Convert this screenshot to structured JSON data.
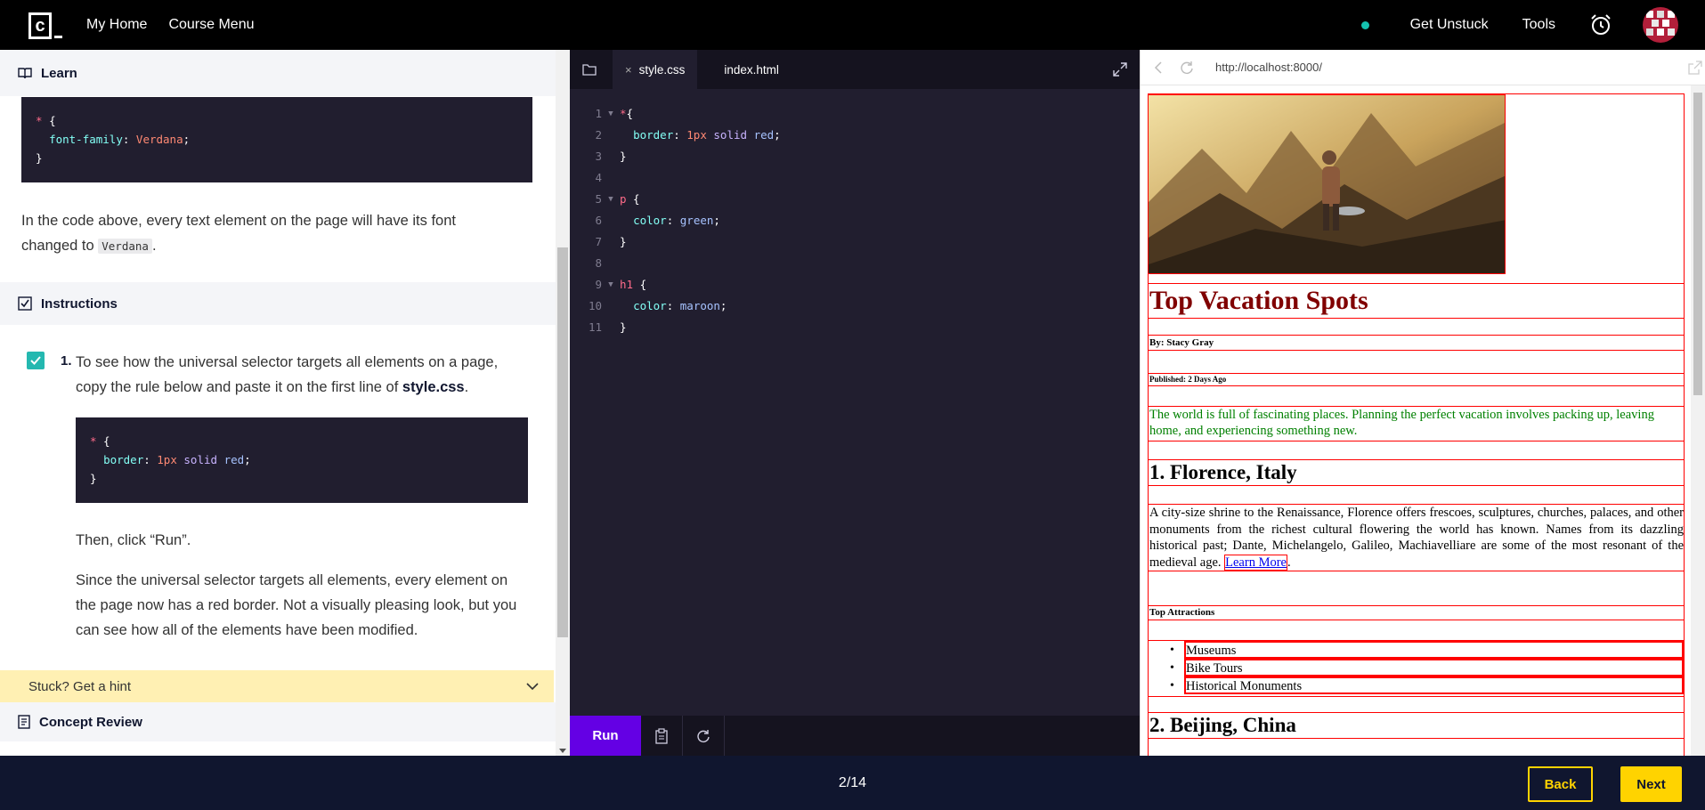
{
  "topbar": {
    "logo_letter": "c",
    "nav": [
      "My Home",
      "Course Menu"
    ],
    "get_unstuck": "Get Unstuck",
    "tools": "Tools"
  },
  "learn": {
    "learn_heading": "Learn",
    "example_code": [
      "* {",
      "  font-family: Verdana;",
      "}"
    ],
    "para1_a": "In the code above, every text element on the page will have its font changed to ",
    "para1_code": "Verdana",
    "para1_b": ".",
    "instructions_heading": "Instructions",
    "step_number": "1.",
    "step_text_a": "To see how the universal selector targets all elements on a page, copy the rule below and paste it on the first line of ",
    "step_text_bold": "style.css",
    "step_text_b": ".",
    "step_code": [
      "* {",
      "  border: 1px solid red;",
      "}"
    ],
    "then_click": "Then, click “Run”.",
    "since_text": "Since the universal selector targets all elements, every element on the page now has a red border. Not a visually pleasing look, but you can see how all of the elements have been modified.",
    "hint": "Stuck? Get a hint",
    "concept_review": "Concept Review"
  },
  "editor": {
    "tabs": [
      "style.css",
      "index.html"
    ],
    "close_glyph": "×",
    "line_numbers": [
      "1",
      "2",
      "3",
      "4",
      "5",
      "6",
      "7",
      "8",
      "9",
      "10",
      "11"
    ],
    "run_label": "Run"
  },
  "browser": {
    "url": "http://localhost:8000/",
    "title": "Top Vacation Spots",
    "byline": "By: Stacy Gray",
    "published": "Published: 2 Days Ago",
    "intro": "The world is full of fascinating places. Planning the perfect vacation involves packing up, leaving home, and experiencing something new.",
    "dest1_heading": "1. Florence, Italy",
    "dest1_text": "A city-size shrine to the Renaissance, Florence offers frescoes, sculptures, churches, palaces, and other monuments from the richest cultural flowering the world has known. Names from its dazzling historical past; Dante, Michelangelo, Galileo, Machiavelliare are some of the most resonant of the medieval age. ",
    "learn_more": "Learn More",
    "learn_more_after": ".",
    "top_attractions": "Top Attractions",
    "attractions": [
      "Museums",
      "Bike Tours",
      "Historical Monuments"
    ],
    "dest2_heading": "2. Beijing, China"
  },
  "footer": {
    "progress": "2/14",
    "back": "Back",
    "next": "Next"
  },
  "colors": {
    "accent_purple": "#6400e4",
    "yellow": "#ffd300",
    "teal": "#14c2b0",
    "navy": "#10162f",
    "editor_bg": "#211e2f",
    "red_border": "#ff0000",
    "maroon": "#800000",
    "green": "#008000"
  },
  "icons": [
    "logo-icon",
    "status-dot-icon",
    "alarm-clock-icon",
    "avatar",
    "book-icon",
    "checkbox-icon",
    "chevron-down-icon",
    "document-icon",
    "folder-icon",
    "expand-icon",
    "clipboard-icon",
    "refresh-icon",
    "back-arrow-icon",
    "reload-icon",
    "external-link-icon"
  ]
}
